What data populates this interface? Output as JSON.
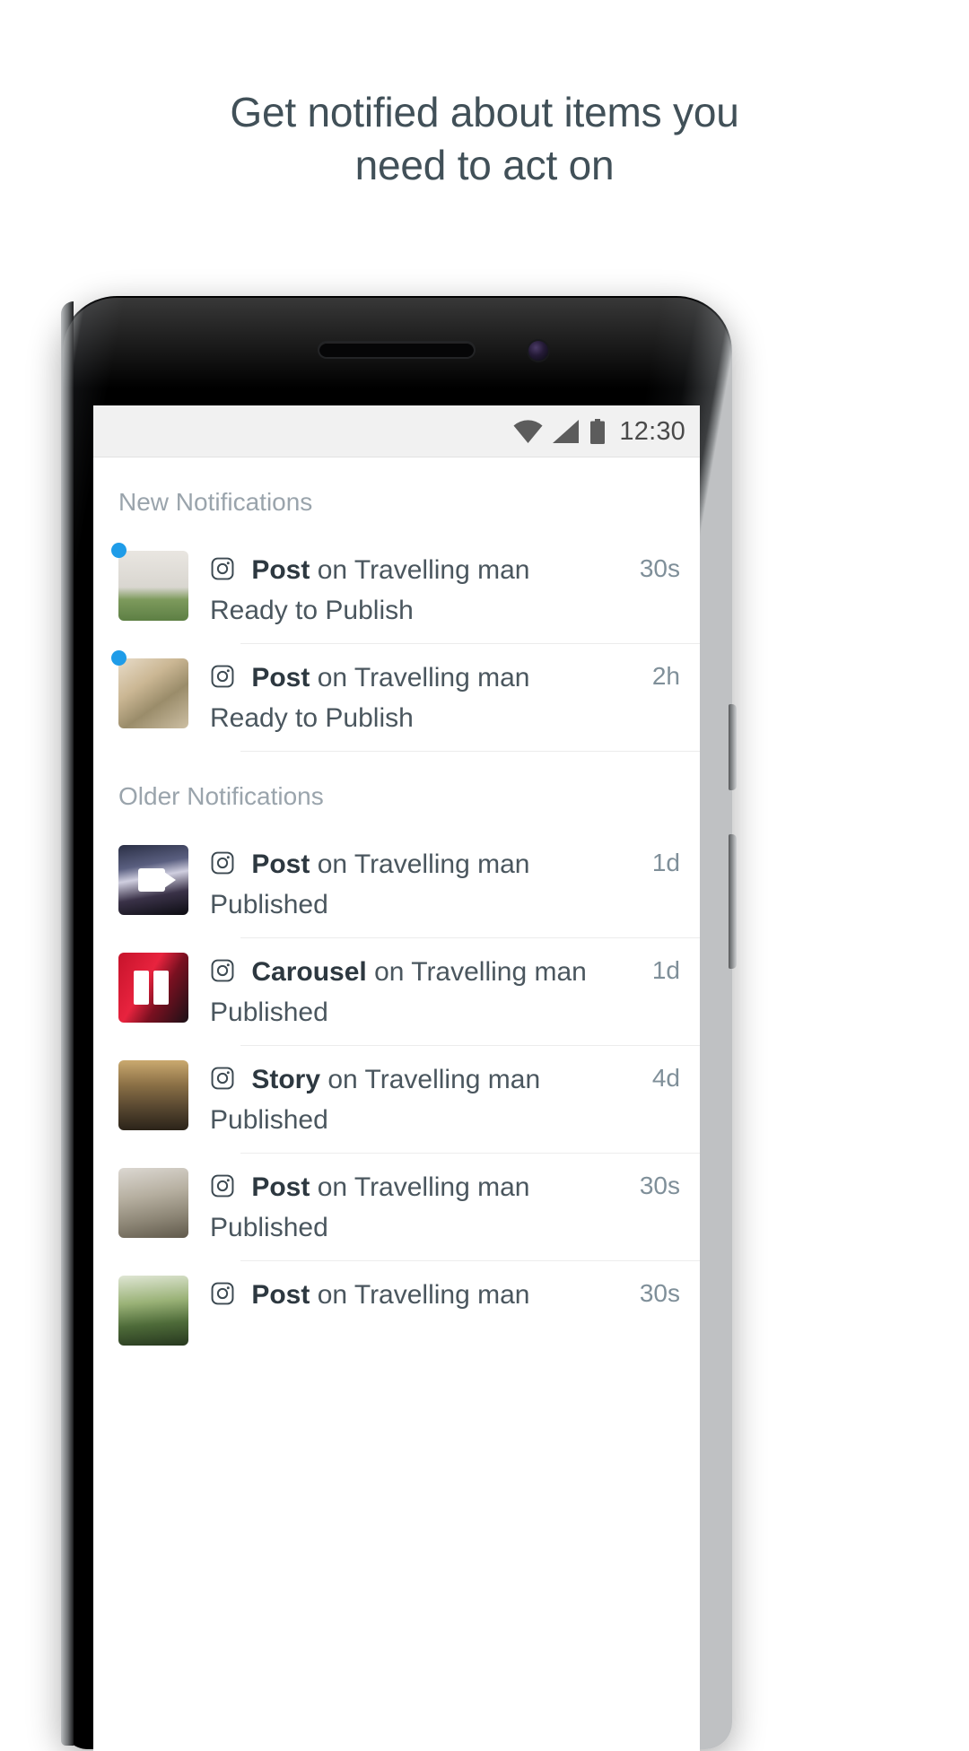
{
  "headline": {
    "line1": "Get notified about items you",
    "line2": "need to act on",
    "color": "#415058"
  },
  "phone": {
    "status_bar": {
      "time": "12:30",
      "icons": [
        "wifi-icon",
        "signal-icon",
        "battery-icon"
      ],
      "background": "#f1f1f1"
    }
  },
  "screen": {
    "sections": [
      {
        "title": "New Notifications",
        "items": [
          {
            "unread": true,
            "thumb": "sc-grass",
            "badge": "none",
            "network_icon": "instagram-icon",
            "type": "Post",
            "target": " on Travelling man",
            "status": "Ready to Publish",
            "time": "30s"
          },
          {
            "unread": true,
            "thumb": "sc-flowers",
            "badge": "none",
            "network_icon": "instagram-icon",
            "type": "Post",
            "target": " on Travelling man",
            "status": "Ready to Publish",
            "time": "2h"
          }
        ]
      },
      {
        "title": "Older Notifications",
        "items": [
          {
            "unread": false,
            "thumb": "sc-concert",
            "badge": "video",
            "network_icon": "instagram-icon",
            "type": "Post",
            "target": " on Travelling man",
            "status": "Published",
            "time": "1d"
          },
          {
            "unread": false,
            "thumb": "sc-red",
            "badge": "carousel",
            "network_icon": "instagram-icon",
            "type": "Carousel",
            "target": " on Travelling man",
            "status": "Published",
            "time": "1d"
          },
          {
            "unread": false,
            "thumb": "sc-street",
            "badge": "none",
            "network_icon": "instagram-icon",
            "type": "Story",
            "target": " on Travelling man",
            "status": "Published",
            "time": "4d"
          },
          {
            "unread": false,
            "thumb": "sc-wedding",
            "badge": "none",
            "network_icon": "instagram-icon",
            "type": "Post",
            "target": " on Travelling man",
            "status": "Published",
            "time": "30s"
          },
          {
            "unread": false,
            "thumb": "sc-kid",
            "badge": "none",
            "network_icon": "instagram-icon",
            "type": "Post",
            "target": " on Travelling man",
            "status": "",
            "time": "30s"
          }
        ]
      }
    ]
  },
  "colors": {
    "unread_dot": "#1f9ce8",
    "section_header": "#9aa4ac",
    "timestamp": "#7f8f99",
    "body_text": "#4a565e"
  }
}
